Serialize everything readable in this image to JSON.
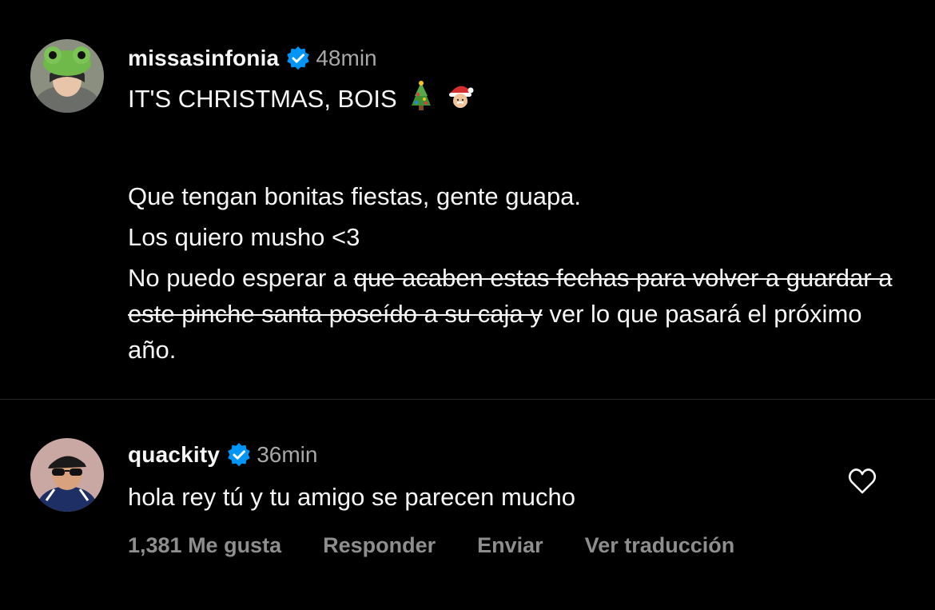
{
  "post": {
    "username": "missasinfonia",
    "time": "48min",
    "line1": "IT'S CHRISTMAS, BOIS",
    "emoji1": "christmas-tree",
    "emoji2": "santa",
    "line2": "Que tengan bonitas fiestas, gente guapa.",
    "line3": "Los quiero musho <3",
    "line4_start": "No puedo esperar a ",
    "line4_strike": "que acaben estas fechas para volver a guardar a este pinche santa poseído a su caja y",
    "line4_end": " ver lo que pasará el próximo año."
  },
  "comment": {
    "username": "quackity",
    "time": "36min",
    "text": "hola rey tú y tu amigo se parecen mucho",
    "likes": "1,381 Me gusta",
    "reply": "Responder",
    "send": "Enviar",
    "translate": "Ver traducción"
  },
  "colors": {
    "background": "#000000",
    "text": "#f5f5f5",
    "muted": "#a8a8a8",
    "action": "#8e8e8e",
    "verified": "#0095f6"
  }
}
